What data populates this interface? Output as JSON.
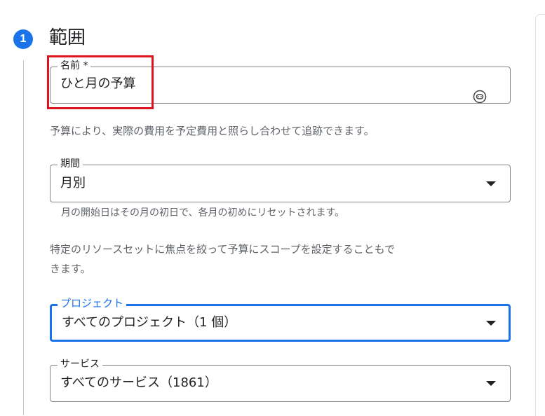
{
  "step": {
    "number": "1",
    "title": "範囲"
  },
  "name_field": {
    "label": "名前 *",
    "value": "ひと月の予算",
    "icon": "assist-icon"
  },
  "description": "予算により、実際の費用を予定費用と照らし合わせて追跡できます。",
  "period_field": {
    "label": "期間",
    "value": "月別",
    "helper": "月の開始日はその月の初日で、各月の初めにリセットされます。"
  },
  "scope_description": {
    "line1": "特定のリソースセットに焦点を絞って予算にスコープを設定することもで",
    "line2": "きます。"
  },
  "project_field": {
    "label": "プロジェクト",
    "value": "すべてのプロジェクト（1 個）"
  },
  "service_field": {
    "label": "サービス",
    "value": "すべてのサービス（1861）"
  },
  "colors": {
    "accent": "#1a73e8",
    "highlight": "#e0141e"
  }
}
